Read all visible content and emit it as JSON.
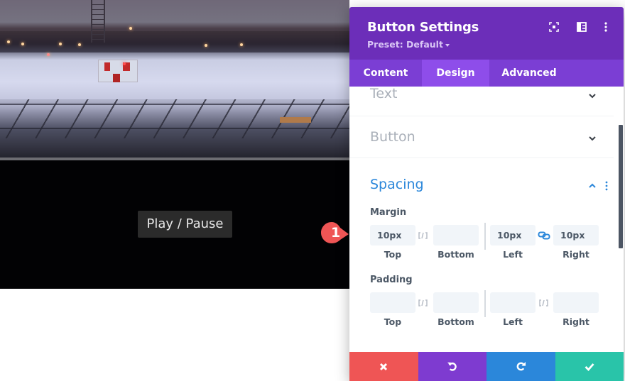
{
  "video": {
    "play_pause_label": "Play / Pause"
  },
  "callout": {
    "number": "1",
    "color": "#ef5555"
  },
  "panel": {
    "title": "Button Settings",
    "preset": "Preset: Default",
    "header_icons": [
      "focus-mode-icon",
      "split-layout-icon",
      "more-options-icon"
    ],
    "header_color": "#6c2eb9",
    "tabs": [
      {
        "label": "Content",
        "active": false
      },
      {
        "label": "Design",
        "active": true
      },
      {
        "label": "Advanced",
        "active": false
      }
    ],
    "sections": [
      {
        "title": "Text",
        "expanded": false
      },
      {
        "title": "Button",
        "expanded": false
      },
      {
        "title": "Spacing",
        "expanded": true
      }
    ],
    "spacing": {
      "margin": {
        "label": "Margin",
        "fields": [
          {
            "label": "Top",
            "value": "10px"
          },
          {
            "label": "Bottom",
            "value": ""
          },
          {
            "label": "Left",
            "value": "10px"
          },
          {
            "label": "Right",
            "value": "10px"
          }
        ],
        "top_bottom_linked": false,
        "left_right_linked": true
      },
      "padding": {
        "label": "Padding",
        "fields": [
          {
            "label": "Top",
            "value": ""
          },
          {
            "label": "Bottom",
            "value": ""
          },
          {
            "label": "Left",
            "value": ""
          },
          {
            "label": "Right",
            "value": ""
          }
        ],
        "top_bottom_linked": false,
        "left_right_linked": false
      }
    },
    "footer": {
      "buttons": [
        {
          "name": "cancel",
          "icon": "close-icon",
          "color": "#ef5555"
        },
        {
          "name": "undo",
          "icon": "undo-icon",
          "color": "#7e3bd0"
        },
        {
          "name": "redo",
          "icon": "redo-icon",
          "color": "#2b87da"
        },
        {
          "name": "save",
          "icon": "check-icon",
          "color": "#29c4a9"
        }
      ]
    }
  }
}
